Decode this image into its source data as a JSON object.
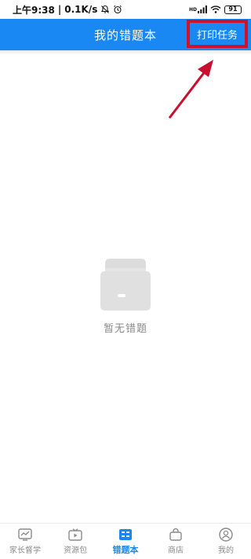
{
  "status_bar": {
    "time": "上午9:38",
    "network_speed": "0.1K/s",
    "signal_label": "HD",
    "battery": "91"
  },
  "header": {
    "title": "我的错题本",
    "print_button": "打印任务",
    "accent_color": "#1a88f2",
    "highlight_color": "#d0112b"
  },
  "empty_state": {
    "message": "暂无错题"
  },
  "tabs": [
    {
      "label": "家长督学",
      "icon": "trend-chart-icon",
      "active": false
    },
    {
      "label": "资源包",
      "icon": "tv-play-icon",
      "active": false
    },
    {
      "label": "错题本",
      "icon": "notebook-icon",
      "active": true
    },
    {
      "label": "商店",
      "icon": "shopping-bag-icon",
      "active": false
    },
    {
      "label": "我的",
      "icon": "profile-icon",
      "active": false
    }
  ]
}
